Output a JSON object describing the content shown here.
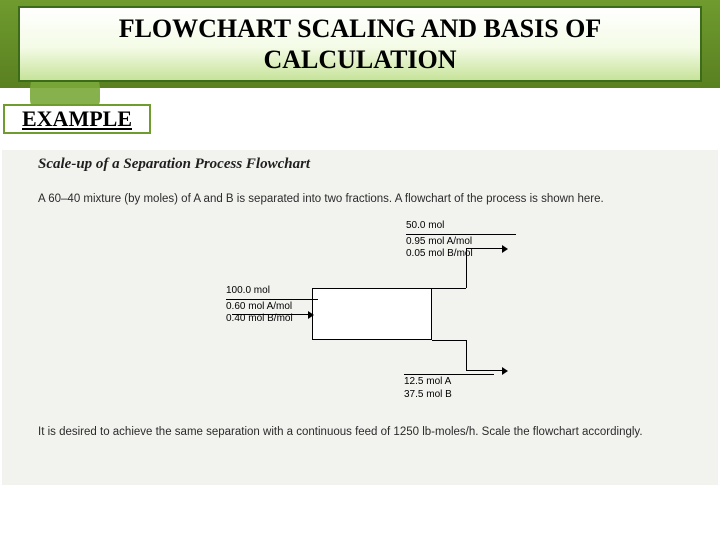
{
  "header": {
    "title": "FLOWCHART SCALING AND BASIS OF CALCULATION"
  },
  "example": {
    "label": "EXAMPLE"
  },
  "scan": {
    "subtitle": "Scale-up of a Separation Process Flowchart",
    "p1": "A 60–40 mixture (by moles) of A and B is separated into two fractions. A flowchart of the process is shown here.",
    "p2": "It is desired to achieve the same separation with a continuous feed of 1250 lb-moles/h. Scale the flowchart accordingly."
  },
  "diagram": {
    "feed": {
      "total": "100.0 mol",
      "line1": "0.60 mol A/mol",
      "line2": "0.40 mol B/mol"
    },
    "top": {
      "total": "50.0 mol",
      "line1": "0.95 mol A/mol",
      "line2": "0.05 mol B/mol"
    },
    "bottom": {
      "line1": "12.5 mol A",
      "line2": "37.5 mol B"
    }
  }
}
